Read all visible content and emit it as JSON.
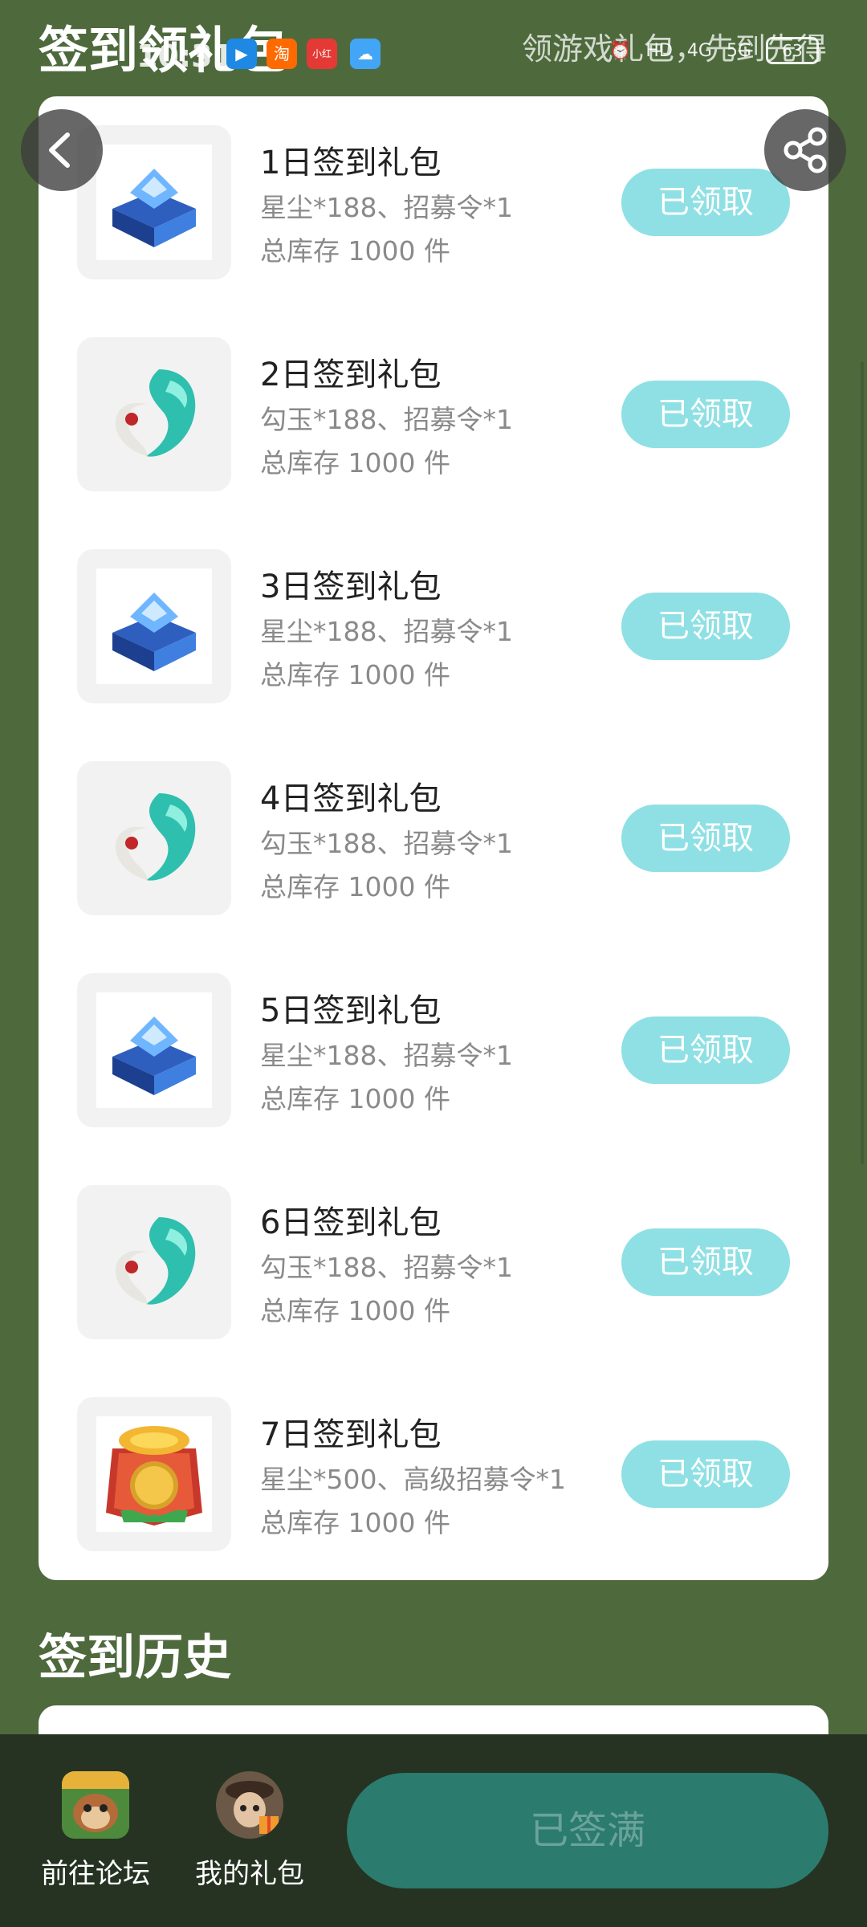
{
  "status_bar": {
    "time": "10:31",
    "battery": "63",
    "network": [
      "4G",
      "5G"
    ],
    "hd_label": "HD"
  },
  "header": {
    "title": "签到领礼包",
    "hint": "领游戏礼包，先到先得"
  },
  "gifts": [
    {
      "name": "1日签到礼包",
      "desc": "星尘*188、招募令*1",
      "stock": "总库存 1000 件",
      "button": "已领取",
      "icon": "crystal-chest"
    },
    {
      "name": "2日签到礼包",
      "desc": "勾玉*188、招募令*1",
      "stock": "总库存 1000 件",
      "button": "已领取",
      "icon": "magatama"
    },
    {
      "name": "3日签到礼包",
      "desc": "星尘*188、招募令*1",
      "stock": "总库存 1000 件",
      "button": "已领取",
      "icon": "crystal-chest"
    },
    {
      "name": "4日签到礼包",
      "desc": "勾玉*188、招募令*1",
      "stock": "总库存 1000 件",
      "button": "已领取",
      "icon": "magatama"
    },
    {
      "name": "5日签到礼包",
      "desc": "星尘*188、招募令*1",
      "stock": "总库存 1000 件",
      "button": "已领取",
      "icon": "crystal-chest"
    },
    {
      "name": "6日签到礼包",
      "desc": "勾玉*188、招募令*1",
      "stock": "总库存 1000 件",
      "button": "已领取",
      "icon": "magatama"
    },
    {
      "name": "7日签到礼包",
      "desc": "星尘*500、高级招募令*1",
      "stock": "总库存 1000 件",
      "button": "已领取",
      "icon": "recruit-seal"
    }
  ],
  "history": {
    "title": "签到历史"
  },
  "bottom_bar": {
    "forum_label": "前往论坛",
    "gifts_label": "我的礼包",
    "signin_button": "已签满"
  },
  "colors": {
    "background": "#4e6a3d",
    "claimed_button": "#8fe0e4",
    "primary_button": "#2b7b6f",
    "bottom_bar": "#263322"
  }
}
